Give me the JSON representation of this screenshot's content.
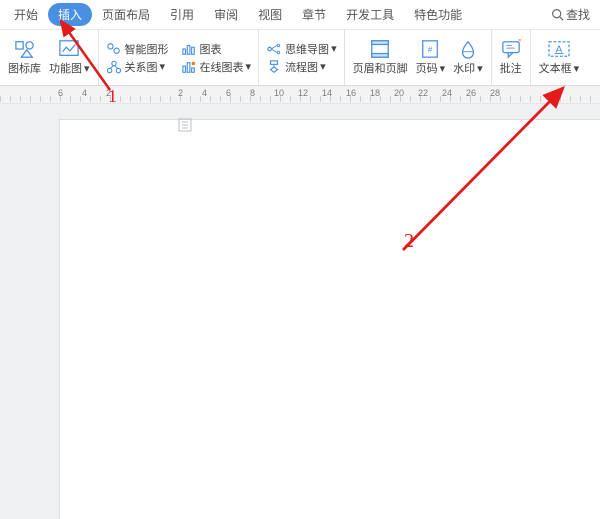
{
  "menu": {
    "start": "开始",
    "insert": "插入",
    "layout": "页面布局",
    "reference": "引用",
    "review": "审阅",
    "view": "视图",
    "chapter": "章节",
    "dev": "开发工具",
    "special": "特色功能",
    "search": "查找"
  },
  "ribbon": {
    "iconlib": "图标库",
    "funcimg": "功能图",
    "smartg": "智能图形",
    "chart": "图表",
    "relation": "关系图",
    "onlinechart": "在线图表",
    "mindmap": "思维导图",
    "flow": "流程图",
    "headerfooter": "页眉和页脚",
    "pagenum": "页码",
    "watermark": "水印",
    "comment": "批注",
    "textbox": "文本框"
  },
  "ruler": [
    "6",
    "4",
    "2",
    "2",
    "4",
    "6",
    "8",
    "10",
    "12",
    "14",
    "16",
    "18",
    "20",
    "22",
    "24",
    "26",
    "28"
  ],
  "annot": {
    "one": "1",
    "two": "2"
  },
  "colors": {
    "accent": "#4a90e2",
    "anno": "#e31b1b"
  }
}
